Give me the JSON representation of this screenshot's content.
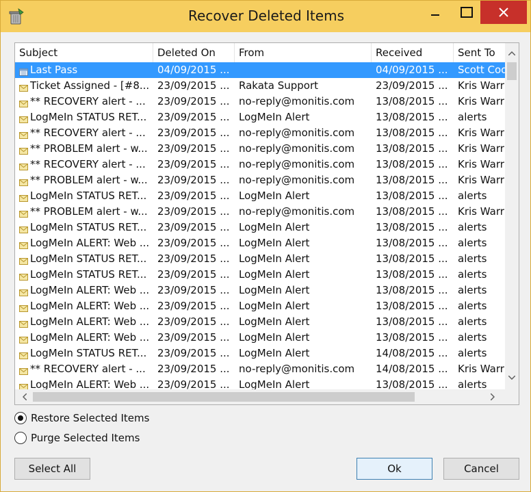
{
  "window": {
    "title": "Recover Deleted Items"
  },
  "columns": [
    {
      "label": "Subject"
    },
    {
      "label": "Deleted On"
    },
    {
      "label": "From"
    },
    {
      "label": "Received"
    },
    {
      "label": "Sent To"
    }
  ],
  "rows": [
    {
      "icon": "calendar-icon",
      "subject": "Last Pass",
      "deleted": "04/09/2015 ...",
      "from": "",
      "received": "04/09/2015 ...",
      "sent_to": "Scott Coo",
      "selected": true
    },
    {
      "icon": "envelope-icon",
      "subject": "Ticket Assigned - [#8...",
      "deleted": "23/09/2015 ...",
      "from": "Rakata Support",
      "received": "23/09/2015 ...",
      "sent_to": "Kris Warr"
    },
    {
      "icon": "envelope-icon",
      "subject": "** RECOVERY alert - ...",
      "deleted": "23/09/2015 ...",
      "from": "no-reply@monitis.com",
      "received": "13/08/2015 ...",
      "sent_to": "Kris Warr"
    },
    {
      "icon": "envelope-icon",
      "subject": "LogMeIn STATUS RET...",
      "deleted": "23/09/2015 ...",
      "from": "LogMeIn Alert",
      "received": "13/08/2015 ...",
      "sent_to": "alerts"
    },
    {
      "icon": "envelope-icon",
      "subject": "** RECOVERY alert - ...",
      "deleted": "23/09/2015 ...",
      "from": "no-reply@monitis.com",
      "received": "13/08/2015 ...",
      "sent_to": "Kris Warr"
    },
    {
      "icon": "envelope-icon",
      "subject": "** PROBLEM alert - w...",
      "deleted": "23/09/2015 ...",
      "from": "no-reply@monitis.com",
      "received": "13/08/2015 ...",
      "sent_to": "Kris Warr"
    },
    {
      "icon": "envelope-icon",
      "subject": "** RECOVERY alert - ...",
      "deleted": "23/09/2015 ...",
      "from": "no-reply@monitis.com",
      "received": "13/08/2015 ...",
      "sent_to": "Kris Warr"
    },
    {
      "icon": "envelope-icon",
      "subject": "** PROBLEM alert - w...",
      "deleted": "23/09/2015 ...",
      "from": "no-reply@monitis.com",
      "received": "13/08/2015 ...",
      "sent_to": "Kris Warr"
    },
    {
      "icon": "envelope-icon",
      "subject": "LogMeIn STATUS RET...",
      "deleted": "23/09/2015 ...",
      "from": "LogMeIn Alert",
      "received": "13/08/2015 ...",
      "sent_to": "alerts"
    },
    {
      "icon": "envelope-icon",
      "subject": "** PROBLEM alert - w...",
      "deleted": "23/09/2015 ...",
      "from": "no-reply@monitis.com",
      "received": "13/08/2015 ...",
      "sent_to": "Kris Warr"
    },
    {
      "icon": "envelope-icon",
      "subject": "LogMeIn STATUS RET...",
      "deleted": "23/09/2015 ...",
      "from": "LogMeIn Alert",
      "received": "13/08/2015 ...",
      "sent_to": "alerts"
    },
    {
      "icon": "envelope-icon",
      "subject": "LogMeIn ALERT: Web ...",
      "deleted": "23/09/2015 ...",
      "from": "LogMeIn Alert",
      "received": "13/08/2015 ...",
      "sent_to": "alerts"
    },
    {
      "icon": "envelope-icon",
      "subject": "LogMeIn STATUS RET...",
      "deleted": "23/09/2015 ...",
      "from": "LogMeIn Alert",
      "received": "13/08/2015 ...",
      "sent_to": "alerts"
    },
    {
      "icon": "envelope-icon",
      "subject": "LogMeIn STATUS RET...",
      "deleted": "23/09/2015 ...",
      "from": "LogMeIn Alert",
      "received": "13/08/2015 ...",
      "sent_to": "alerts"
    },
    {
      "icon": "envelope-icon",
      "subject": "LogMeIn ALERT: Web ...",
      "deleted": "23/09/2015 ...",
      "from": "LogMeIn Alert",
      "received": "13/08/2015 ...",
      "sent_to": "alerts"
    },
    {
      "icon": "envelope-icon",
      "subject": "LogMeIn ALERT: Web ...",
      "deleted": "23/09/2015 ...",
      "from": "LogMeIn Alert",
      "received": "13/08/2015 ...",
      "sent_to": "alerts"
    },
    {
      "icon": "envelope-icon",
      "subject": "LogMeIn ALERT: Web ...",
      "deleted": "23/09/2015 ...",
      "from": "LogMeIn Alert",
      "received": "13/08/2015 ...",
      "sent_to": "alerts"
    },
    {
      "icon": "envelope-icon",
      "subject": "LogMeIn ALERT: Web ...",
      "deleted": "23/09/2015 ...",
      "from": "LogMeIn Alert",
      "received": "13/08/2015 ...",
      "sent_to": "alerts"
    },
    {
      "icon": "envelope-icon",
      "subject": "LogMeIn STATUS RET...",
      "deleted": "23/09/2015 ...",
      "from": "LogMeIn Alert",
      "received": "14/08/2015 ...",
      "sent_to": "alerts"
    },
    {
      "icon": "envelope-icon",
      "subject": "** RECOVERY alert - ...",
      "deleted": "23/09/2015 ...",
      "from": "no-reply@monitis.com",
      "received": "14/08/2015 ...",
      "sent_to": "Kris Warr"
    },
    {
      "icon": "envelope-icon",
      "subject": "LogMeIn ALERT: Web ...",
      "deleted": "23/09/2015 ...",
      "from": "LogMeIn Alert",
      "received": "13/08/2015 ...",
      "sent_to": "alerts"
    }
  ],
  "options": {
    "restore": {
      "label": "Restore Selected Items",
      "checked": true
    },
    "purge": {
      "label": "Purge Selected Items",
      "checked": false
    }
  },
  "buttons": {
    "select_all": "Select All",
    "ok": "Ok",
    "cancel": "Cancel"
  },
  "colors": {
    "titlebar": "#f6ce5f",
    "close": "#c7302a",
    "selection": "#3399ff"
  }
}
